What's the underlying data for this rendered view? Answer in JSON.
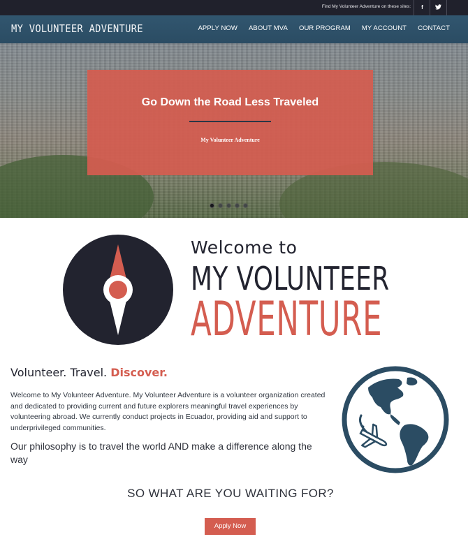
{
  "topbar": {
    "find_text": "Find My Volunteer Adventure on these sites:",
    "social": [
      {
        "icon": "facebook-icon",
        "glyph": "f"
      },
      {
        "icon": "twitter-icon",
        "glyph": "ᵭ"
      }
    ]
  },
  "header": {
    "logo": "MY VOLUNTEER ADVENTURE",
    "nav": [
      "APPLY NOW",
      "ABOUT MVA",
      "OUR PROGRAM",
      "MY ACCOUNT",
      "CONTACT"
    ]
  },
  "hero": {
    "title": "Go Down the Road Less Traveled",
    "subtitle": "My Volunteer Adventure",
    "slide_count": 5,
    "active_slide": 1
  },
  "welcome": {
    "line_top": "Welcome to",
    "line_mid": "MY VOLUNTEER",
    "line_bottom": "ADVENTURE"
  },
  "intro": {
    "tagline_part1": "Volunteer. Travel. ",
    "tagline_accent": "Discover.",
    "body": "Welcome to My Volunteer Adventure. My Volunteer Adventure is a volunteer organization created and dedicated to providing current and future explorers meaningful travel experiences by volunteering abroad. We currently conduct projects in Ecuador, providing aid and support to underprivileged communities.",
    "philosophy": "Our philosophy is to travel the world AND make a difference along the way"
  },
  "cta": {
    "heading": "SO WHAT ARE YOU WAITING FOR?",
    "button": "Apply Now"
  },
  "colors": {
    "accent": "#d45d50",
    "navy": "#22232f",
    "nav_bg": "#2f5169",
    "globe": "#2b4c63"
  }
}
